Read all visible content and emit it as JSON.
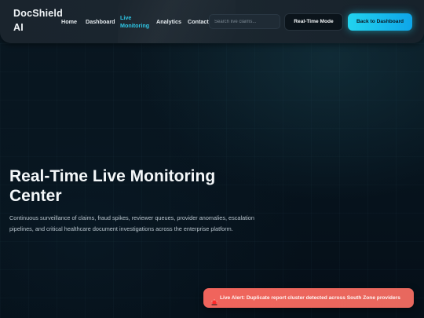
{
  "header": {
    "brand": "DocShield AI",
    "nav": [
      {
        "label": "Home",
        "active": false
      },
      {
        "label": "Dashboard",
        "active": false
      },
      {
        "label": "Live Monitoring",
        "active": true
      },
      {
        "label": "Analytics",
        "active": false
      },
      {
        "label": "Contact",
        "active": false
      }
    ],
    "search": {
      "placeholder": "Search live claims...",
      "value": ""
    },
    "realtime_label": "Real-Time Mode",
    "back_label": "Back to Dashboard"
  },
  "hero": {
    "title": "Real-Time Live Monitoring Center",
    "description": "Continuous surveillance of claims, fraud spikes, reviewer queues, provider anomalies, escalation pipelines, and critical healthcare document investigations across the enterprise platform."
  },
  "alert": {
    "icon": "siren-icon",
    "text": "Live Alert: Duplicate report cluster detected across South Zone providers"
  },
  "colors": {
    "accent": "#22d3ee",
    "active_nav": "#2ec7e6",
    "alert": "#f0645c",
    "background": "#06121c"
  }
}
